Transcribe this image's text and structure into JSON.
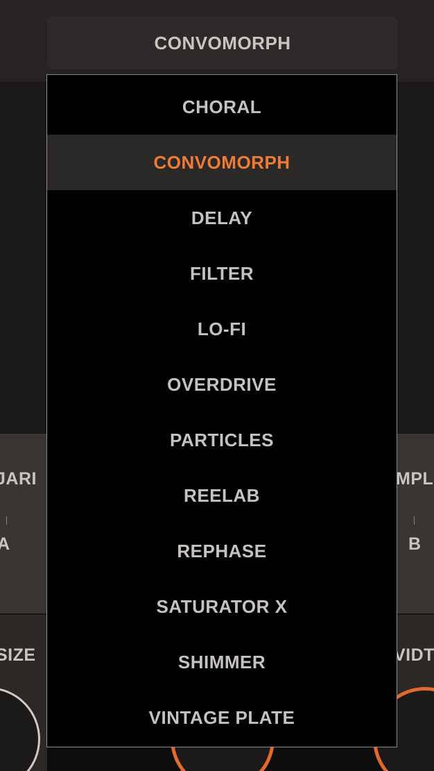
{
  "dropdown": {
    "current_value": "CONVOMORPH",
    "selected_index": 1,
    "options": [
      "CHORAL",
      "CONVOMORPH",
      "DELAY",
      "FILTER",
      "LO-FI",
      "OVERDRIVE",
      "PARTICLES",
      "REELAB",
      "REPHASE",
      "SATURATOR X",
      "SHIMMER",
      "VINTAGE PLATE"
    ]
  },
  "background": {
    "left_labels": {
      "param_top": "JARI",
      "param_value": "A",
      "knob_label": "SIZE"
    },
    "right_labels": {
      "param_top": "MPL",
      "param_value": "B",
      "knob_label": "VIDT"
    }
  },
  "colors": {
    "accent": "#ef7c33",
    "menu_bg": "#000000",
    "selected_bg": "#2b2828",
    "text": "#c6c2c0"
  }
}
